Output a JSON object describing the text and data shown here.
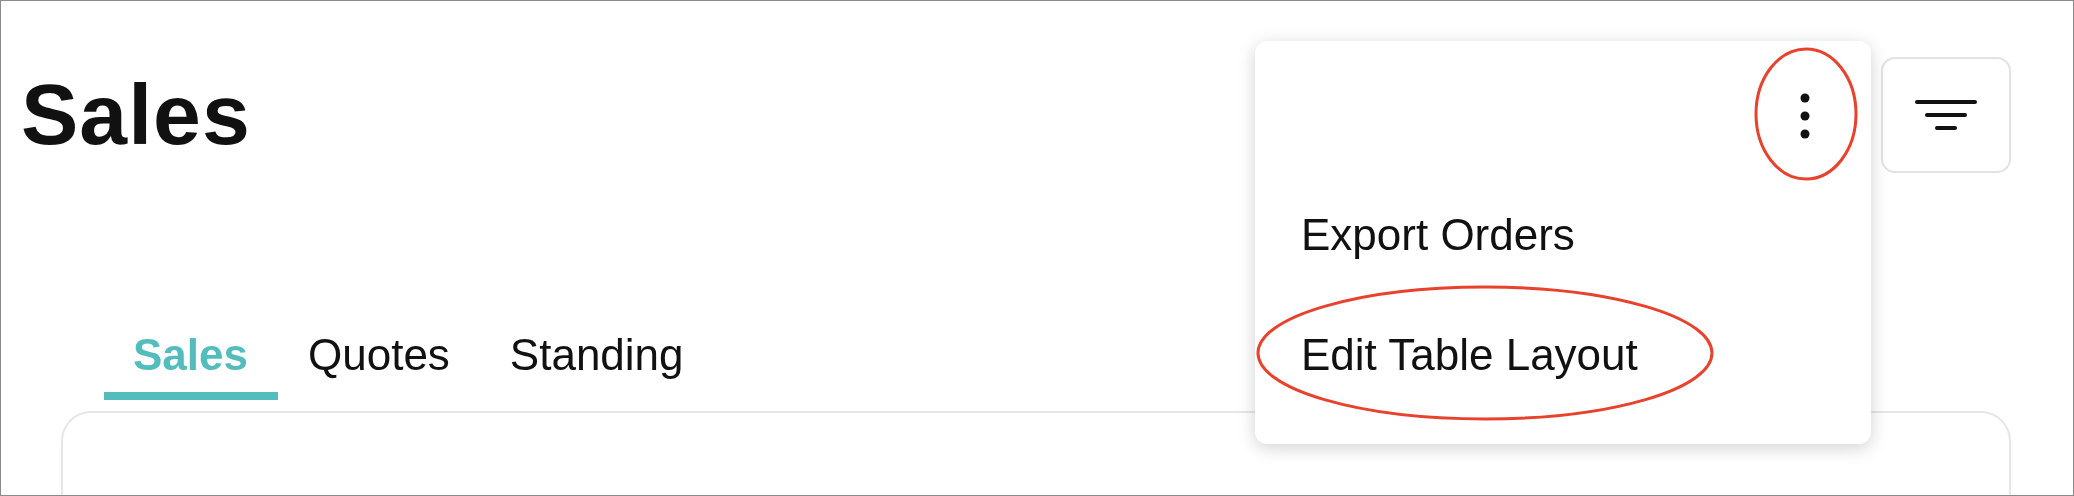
{
  "page_title": "Sales",
  "more_button": {
    "highlighted": true
  },
  "menu_items": [
    {
      "label": "Export Orders",
      "highlighted": false
    },
    {
      "label": "Edit Table Layout",
      "highlighted": true
    }
  ],
  "tabs": [
    {
      "label": "Sales",
      "selected": true
    },
    {
      "label": "Quotes",
      "selected": false
    },
    {
      "label": "Standing",
      "selected": false
    }
  ]
}
